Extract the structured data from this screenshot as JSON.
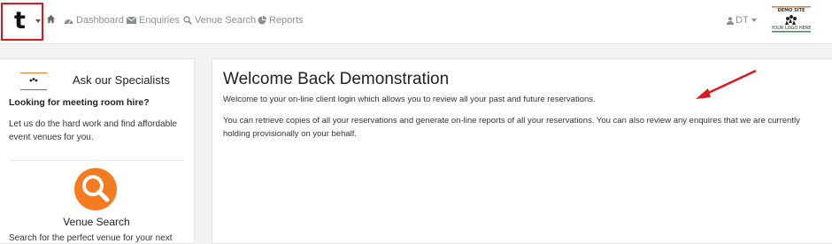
{
  "brand": {
    "letter": "t"
  },
  "nav": {
    "items": [
      {
        "label": "Dashboard",
        "icon": "dashboard-icon"
      },
      {
        "label": "Enquiries",
        "icon": "envelope-icon"
      },
      {
        "label": "Venue Search",
        "icon": "search-icon"
      },
      {
        "label": "Reports",
        "icon": "pie-chart-icon"
      }
    ],
    "user_label": "DT"
  },
  "logo": {
    "line1": "DEMO SITE",
    "line2": "YOUR LOGO HERE"
  },
  "sidebar": {
    "heading": "Ask our Specialists",
    "subheading": "Looking for meeting room hire?",
    "paragraph": "Let us do the hard work and find affordable event venues for you.",
    "venue_title": "Venue Search",
    "venue_text": "Search for the perfect venue for your next"
  },
  "main": {
    "title": "Welcome Back Demonstration",
    "para1": "Welcome to your on-line client login which allows you to review all your past and future reservations.",
    "para2": "You can retrieve copies of all your reservations and generate on-line reports of all your reservations. You can also review any enquires that we are currently holding provisionally on your behalf."
  },
  "colors": {
    "highlight_box": "#e0161e",
    "annotation_arrow": "#e0161e",
    "venue_icon_bg": "#f47b20",
    "nav_text": "#8a8f96"
  }
}
